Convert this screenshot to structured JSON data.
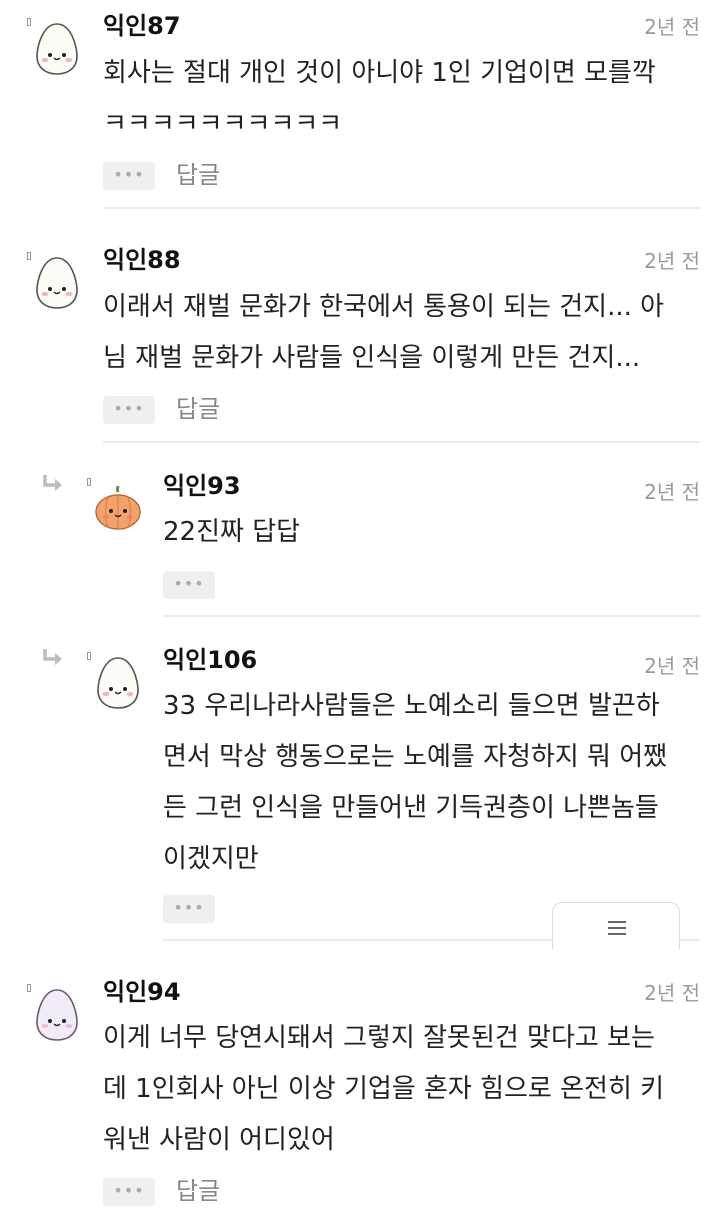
{
  "comments": [
    {
      "nick": "익인87",
      "time": "2년 전",
      "lines": [
        "회사는 절대 개인 것이 아니야 1인 기업이면 모를깍",
        "ㅋㅋㅋㅋㅋㅋㅋㅋㅋㅋ"
      ],
      "more": "•••",
      "reply": "답글",
      "avatar": "egg-face-icon"
    },
    {
      "nick": "익인88",
      "time": "2년 전",
      "lines": [
        "이래서 재벌 문화가 한국에서 통용이 되는 건지... 아",
        "님 재벌 문화가 사람들 인식을 이렇게 만든 건지..."
      ],
      "more": "•••",
      "reply": "답글",
      "avatar": "egg-face-icon"
    },
    {
      "nick": "익인93",
      "time": "2년 전",
      "lines": [
        "22진짜 답답"
      ],
      "more": "•••",
      "avatar": "pumpkin-face-icon"
    },
    {
      "nick": "익인106",
      "time": "2년 전",
      "lines": [
        "33 우리나라사람들은 노예소리 들으면 발끈하",
        "면서 막상 행동으로는 노예를 자청하지 뭐 어쨌",
        "든 그런 인식을 만들어낸 기득권층이 나쁜놈들",
        "이겠지만"
      ],
      "more": "•••",
      "avatar": "egg-face-icon"
    },
    {
      "nick": "익인94",
      "time": "2년 전",
      "lines": [
        "이게 너무 당연시돼서 그렇지 잘못된건 맞다고 보는",
        "데 1인회사 아닌 이상 기업을 혼자 힘으로 온전히 키",
        "워낸 사람이 어디있어"
      ],
      "more": "•••",
      "reply": "답글",
      "avatar": "purple-egg-face-icon"
    }
  ],
  "menu_icon": "hamburger-menu-icon"
}
